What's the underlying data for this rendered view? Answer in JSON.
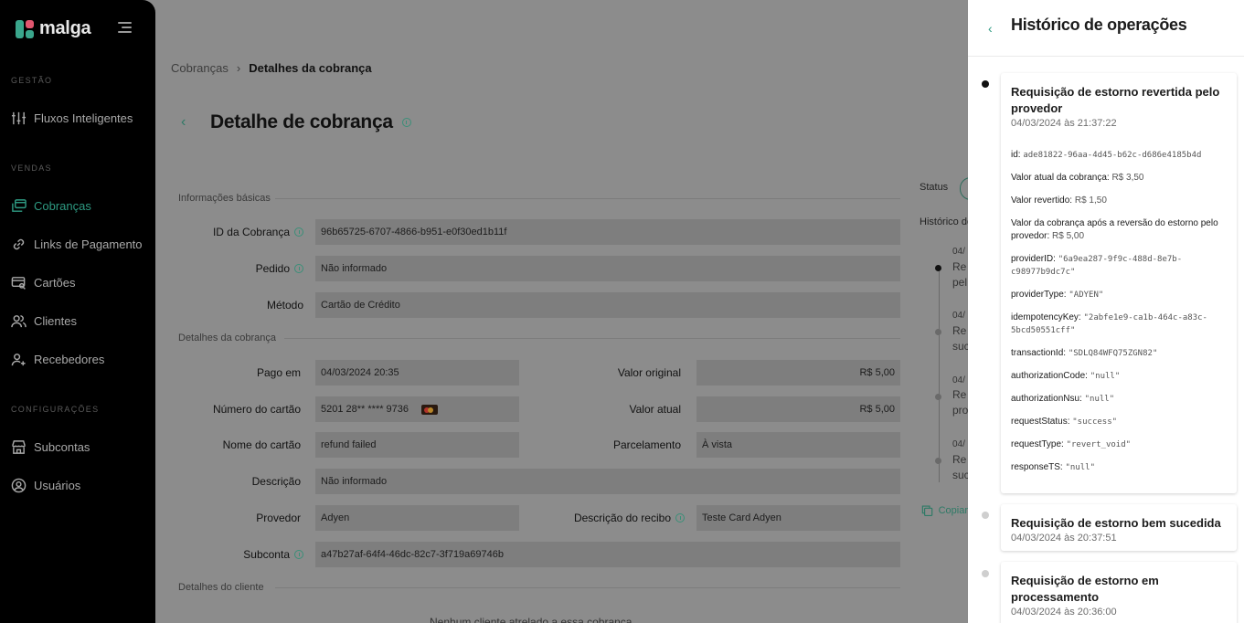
{
  "sidebar": {
    "brand": "malga",
    "sections": {
      "gestao": "GESTÃO",
      "vendas": "VENDAS",
      "configuracoes": "CONFIGURAÇÕES"
    },
    "items": [
      {
        "label": "Fluxos Inteligentes",
        "icon": "sliders-icon"
      },
      {
        "label": "Cobranças",
        "icon": "charges-icon",
        "active": true
      },
      {
        "label": "Links de Pagamento",
        "icon": "link-icon"
      },
      {
        "label": "Cartões",
        "icon": "card-search-icon"
      },
      {
        "label": "Clientes",
        "icon": "users-icon"
      },
      {
        "label": "Recebedores",
        "icon": "user-plus-icon"
      },
      {
        "label": "Subcontas",
        "icon": "store-icon"
      },
      {
        "label": "Usuários",
        "icon": "user-circle-icon"
      }
    ]
  },
  "breadcrumb": {
    "parent": "Cobranças",
    "separator": "›",
    "current": "Detalhes da cobrança"
  },
  "page": {
    "title": "Detalhe de cobrança"
  },
  "basic_info": {
    "label": "Informações básicas",
    "id_label": "ID da Cobrança",
    "id_value": "96b65725-6707-4866-b951-e0f30ed1b11f",
    "order_label": "Pedido",
    "order_value": "Não informado",
    "method_label": "Método",
    "method_value": "Cartão de Crédito"
  },
  "charge_details": {
    "label": "Detalhes da cobrança",
    "paid_label": "Pago em",
    "paid_value": "04/03/2024 20:35",
    "original_label": "Valor original",
    "original_value": "R$ 5,00",
    "card_number_label": "Número do cartão",
    "card_number_value": "5201 28** **** 9736",
    "current_label": "Valor atual",
    "current_value": "R$ 5,00",
    "card_name_label": "Nome do cartão",
    "card_name_value": "refund failed",
    "installments_label": "Parcelamento",
    "installments_value": "À vista",
    "description_label": "Descrição",
    "description_value": "Não informado",
    "provider_label": "Provedor",
    "provider_value": "Adyen",
    "receipt_label": "Descrição do recibo",
    "receipt_value": "Teste Card Adyen",
    "subaccount_label": "Subconta",
    "subaccount_value": "a47b27af-64f4-46dc-82c7-3f719a69746b"
  },
  "client_details": {
    "label": "Detalhes do cliente",
    "empty": "Nenhum cliente atrelado a essa cobrança"
  },
  "side_panel": {
    "status_label": "Status",
    "history_label": "Histórico de operações",
    "copy_label": "Copiar",
    "mini_items": [
      {
        "date": "04/",
        "title_1": "Re",
        "title_2": "pel"
      },
      {
        "date": "04/",
        "title_1": "Re",
        "title_2": "suc"
      },
      {
        "date": "04/",
        "title_1": "Re",
        "title_2": "pro"
      },
      {
        "date": "04/",
        "title_1": "Re",
        "title_2": "suc"
      }
    ]
  },
  "drawer": {
    "title": "Histórico de operações",
    "events": [
      {
        "title": "Requisição de estorno revertida pelo provedor",
        "date": "04/03/2024 às 21:37:22",
        "details": {
          "id_k": "id:",
          "id_v": "ade81822-96aa-4d45-b62c-d686e4185b4d",
          "cur_k": "Valor atual da cobrança:",
          "cur_v": "R$ 3,50",
          "rev_k": "Valor revertido:",
          "rev_v": "R$ 1,50",
          "after_k": "Valor da cobrança após a reversão do estorno pelo provedor:",
          "after_v": "R$ 5,00",
          "pid_k": "providerID:",
          "pid_v": "\"6a9ea287-9f9c-488d-8e7b-c98977b9dc7c\"",
          "ptype_k": "providerType:",
          "ptype_v": "\"ADYEN\"",
          "idem_k": "idempotencyKey:",
          "idem_v": "\"2abfe1e9-ca1b-464c-a83c-5bcd50551cff\"",
          "tx_k": "transactionId:",
          "tx_v": "\"SDLQ84WFQ75ZGN82\"",
          "auth_k": "authorizationCode:",
          "auth_v": "\"null\"",
          "nsu_k": "authorizationNsu:",
          "nsu_v": "\"null\"",
          "rs_k": "requestStatus:",
          "rs_v": "\"success\"",
          "rt_k": "requestType:",
          "rt_v": "\"revert_void\"",
          "ts_k": "responseTS:",
          "ts_v": "\"null\""
        }
      },
      {
        "title": "Requisição de estorno bem sucedida",
        "date": "04/03/2024 às 20:37:51"
      },
      {
        "title": "Requisição de estorno em processamento",
        "date": "04/03/2024 às 20:36:00"
      }
    ]
  }
}
